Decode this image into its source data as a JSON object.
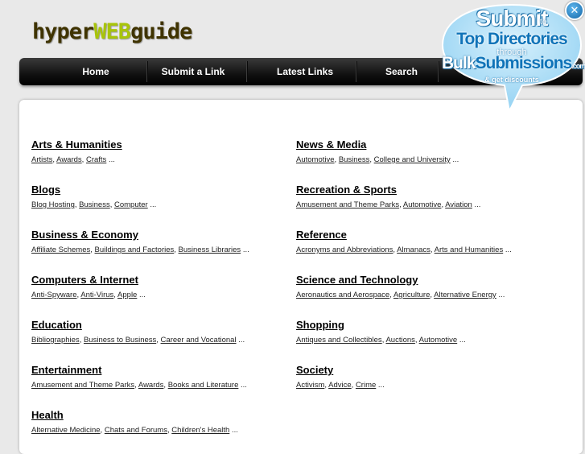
{
  "logo": {
    "part1": "hyper",
    "part2": "WEB",
    "part3": "guide"
  },
  "nav": [
    {
      "label": "Home"
    },
    {
      "label": "Submit a Link"
    },
    {
      "label": "Latest Links"
    },
    {
      "label": "Search"
    }
  ],
  "promo": {
    "line1": "Submit",
    "line1b": "to",
    "line2": "Top Directories",
    "line3": "through",
    "line4a": "Bulk",
    "line4b": "Submissions",
    "line4c": ".com",
    "line5": "& get discounts",
    "close_symbol": "✕"
  },
  "left_categories": [
    {
      "title": "Arts & Humanities",
      "subs": [
        "Artists",
        "Awards",
        "Crafts"
      ],
      "more": "..."
    },
    {
      "title": "Blogs",
      "subs": [
        "Blog Hosting",
        "Business",
        "Computer"
      ],
      "more": "..."
    },
    {
      "title": "Business & Economy",
      "subs": [
        "Affiliate Schemes",
        "Buildings and Factories",
        "Business Libraries"
      ],
      "more": "..."
    },
    {
      "title": "Computers & Internet",
      "subs": [
        "Anti-Spyware",
        "Anti-Virus",
        "Apple"
      ],
      "more": "..."
    },
    {
      "title": "Education",
      "subs": [
        "Bibliographies",
        "Business to Business",
        "Career and Vocational"
      ],
      "more": "..."
    },
    {
      "title": "Entertainment",
      "subs": [
        "Amusement and Theme Parks",
        "Awards",
        "Books and Literature"
      ],
      "more": "..."
    },
    {
      "title": "Health",
      "subs": [
        "Alternative Medicine",
        "Chats and Forums",
        "Children's Health"
      ],
      "more": "..."
    }
  ],
  "right_categories": [
    {
      "title": "News & Media",
      "subs": [
        "Automotive",
        "Business",
        "College and University"
      ],
      "more": "..."
    },
    {
      "title": "Recreation & Sports",
      "subs": [
        "Amusement and Theme Parks",
        "Automotive",
        "Aviation"
      ],
      "more": "..."
    },
    {
      "title": "Reference",
      "subs": [
        "Acronyms and Abbreviations",
        "Almanacs",
        "Arts and Humanities"
      ],
      "more": "..."
    },
    {
      "title": "Science and Technology",
      "subs": [
        "Aeronautics and Aerospace",
        "Agriculture",
        "Alternative Energy"
      ],
      "more": "..."
    },
    {
      "title": "Shopping",
      "subs": [
        "Antiques and Collectibles",
        "Auctions",
        "Automotive"
      ],
      "more": "..."
    },
    {
      "title": "Society",
      "subs": [
        "Activism",
        "Advice",
        "Crime"
      ],
      "more": "..."
    }
  ]
}
